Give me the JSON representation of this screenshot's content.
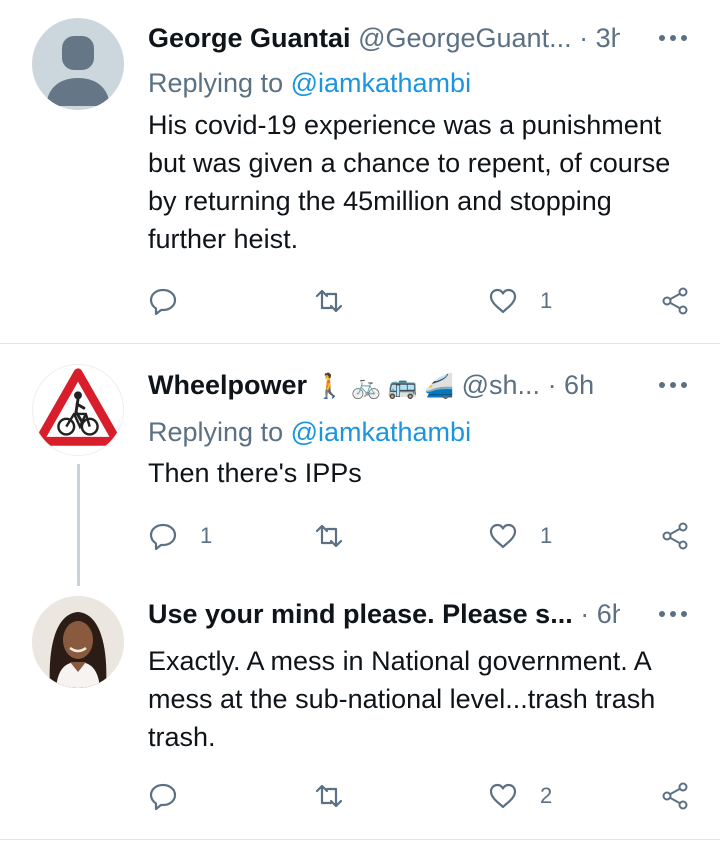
{
  "tweets": [
    {
      "name": "George Guantai",
      "handle": "@GeorgeGuant...",
      "time": "· 3h",
      "replying_prefix": "Replying to ",
      "replying_to": "@iamkathambi",
      "text": "His covid-19 experience was a punishment but was given a chance to repent, of course by returning the 45million and stopping further heist.",
      "reply_count": "",
      "retweet_count": "",
      "like_count": "1"
    },
    {
      "name": "Wheelpower",
      "name_emojis": "🚶 🚲 🚌 🚄",
      "handle": "@sh...",
      "time": "· 6h",
      "replying_prefix": "Replying to ",
      "replying_to": "@iamkathambi",
      "text": "Then there's IPPs",
      "reply_count": "1",
      "retweet_count": "",
      "like_count": "1"
    },
    {
      "name": "Use your mind please. Please s...",
      "time": "· 6h",
      "text": "Exactly. A mess in National government. A mess at the sub-national level...trash trash trash.",
      "reply_count": "",
      "retweet_count": "",
      "like_count": "2"
    }
  ],
  "colors": {
    "secondary": "#5b7083",
    "link": "#1b95e0",
    "divider": "#e1e6ea",
    "thread": "#c9d1d9"
  }
}
